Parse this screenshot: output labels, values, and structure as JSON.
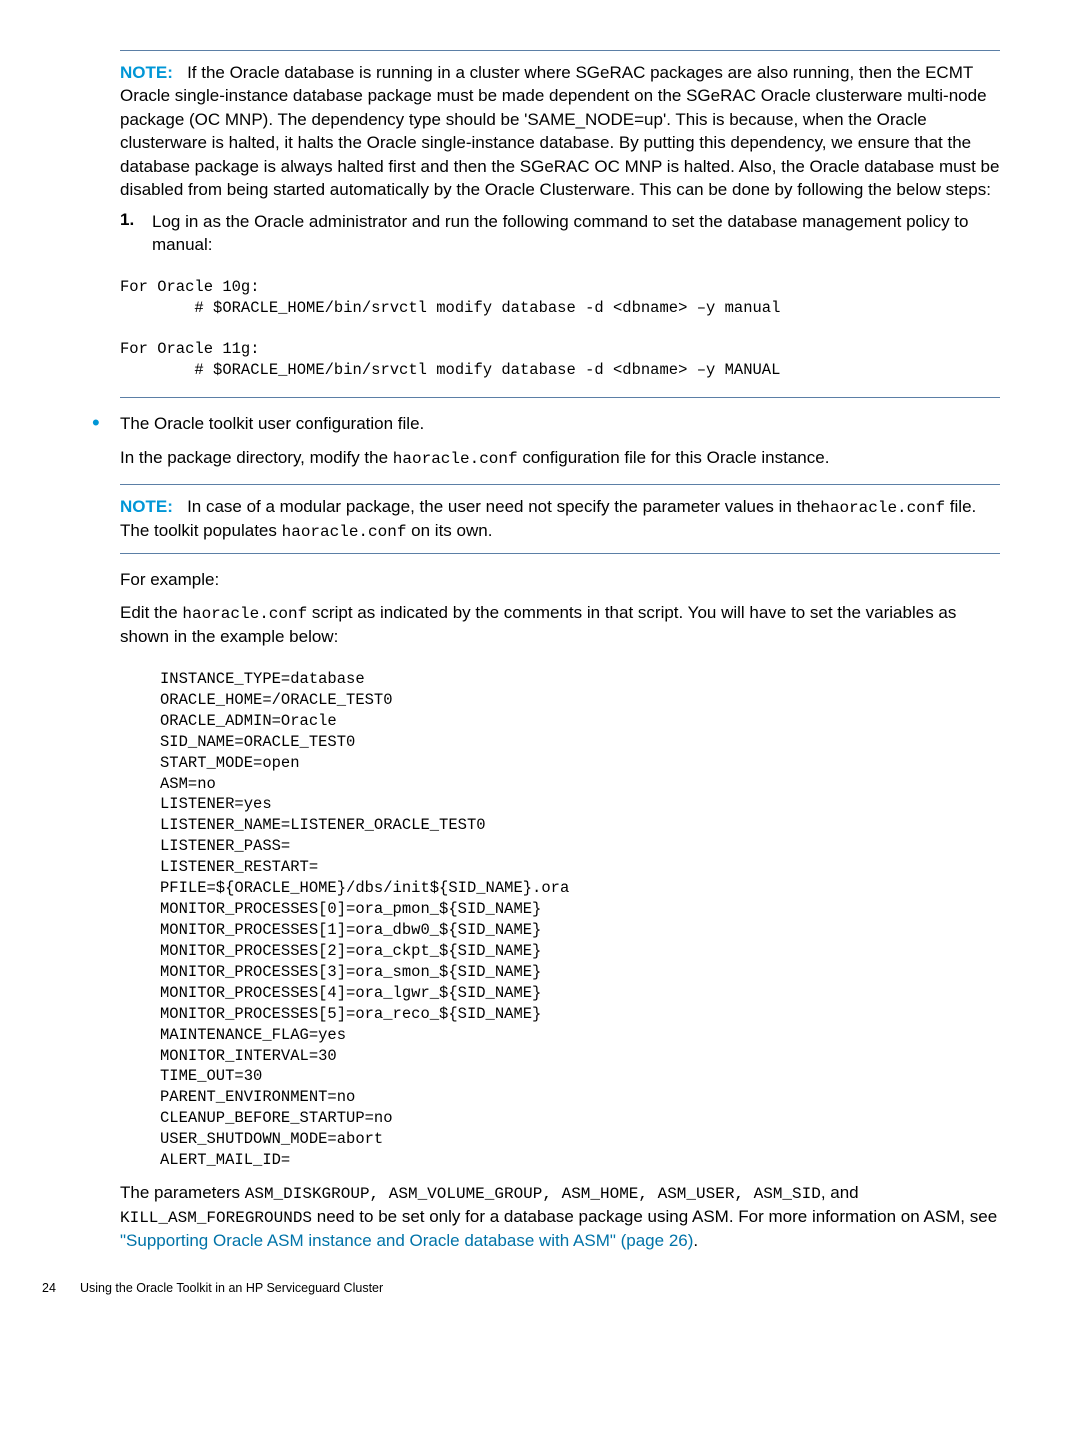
{
  "note1": {
    "label": "NOTE:",
    "text": "If the Oracle database is running in a cluster where SGeRAC packages are also running, then the ECMT Oracle single-instance database package must be made dependent on the SGeRAC Oracle clusterware multi-node package (OC MNP). The dependency type should be 'SAME_NODE=up'. This is because, when the Oracle clusterware is halted, it halts the Oracle single-instance database. By putting this dependency, we ensure that the database package is always halted first and then the SGeRAC OC MNP is halted. Also, the Oracle database must be disabled from being started automatically by the Oracle Clusterware. This can be done by following the below steps:",
    "step_num": "1.",
    "step_text": "Log in as the Oracle administrator and run the following command to set the database management policy to manual:",
    "code": "For Oracle 10g:\n        # $ORACLE_HOME/bin/srvctl modify database -d <dbname> –y manual\n\nFor Oracle 11g:\n        # $ORACLE_HOME/bin/srvctl modify database -d <dbname> –y MANUAL"
  },
  "bullet": {
    "line1": "The Oracle toolkit user configuration file.",
    "line2_a": "In the package directory, modify the ",
    "line2_mono": "haoracle.conf",
    "line2_b": " configuration file for this Oracle instance."
  },
  "note2": {
    "label": "NOTE:",
    "text_a": "In case of a modular package, the user need not specify the parameter values in the",
    "mono1": "haoracle.conf",
    "text_b": " file. The toolkit populates ",
    "mono2": "haoracle.conf",
    "text_c": " on its own."
  },
  "example": {
    "heading": "For example:",
    "line_a": "Edit the ",
    "mono": "haoracle.conf",
    "line_b": " script as indicated by the comments in that script. You will have to set the variables as shown in the example below:",
    "code": "INSTANCE_TYPE=database\nORACLE_HOME=/ORACLE_TEST0\nORACLE_ADMIN=Oracle\nSID_NAME=ORACLE_TEST0\nSTART_MODE=open\nASM=no\nLISTENER=yes\nLISTENER_NAME=LISTENER_ORACLE_TEST0\nLISTENER_PASS=\nLISTENER_RESTART=\nPFILE=${ORACLE_HOME}/dbs/init${SID_NAME}.ora\nMONITOR_PROCESSES[0]=ora_pmon_${SID_NAME}\nMONITOR_PROCESSES[1]=ora_dbw0_${SID_NAME}\nMONITOR_PROCESSES[2]=ora_ckpt_${SID_NAME}\nMONITOR_PROCESSES[3]=ora_smon_${SID_NAME}\nMONITOR_PROCESSES[4]=ora_lgwr_${SID_NAME}\nMONITOR_PROCESSES[5]=ora_reco_${SID_NAME}\nMAINTENANCE_FLAG=yes\nMONITOR_INTERVAL=30\nTIME_OUT=30\nPARENT_ENVIRONMENT=no\nCLEANUP_BEFORE_STARTUP=no\nUSER_SHUTDOWN_MODE=abort\nALERT_MAIL_ID="
  },
  "closing": {
    "a": "The parameters ",
    "m1": "ASM_DISKGROUP, ASM_VOLUME_GROUP, ASM_HOME, ASM_USER, ASM_SID",
    "b": ", and ",
    "m2": "KILL_ASM_FOREGROUNDS",
    "c": "  need to be set only for a database package using ASM. For more information on ASM, see ",
    "link": "\"Supporting Oracle ASM instance and Oracle database with ASM\" (page 26)",
    "d": "."
  },
  "footer": {
    "num": "24",
    "text": "Using the Oracle Toolkit in an HP Serviceguard Cluster"
  }
}
